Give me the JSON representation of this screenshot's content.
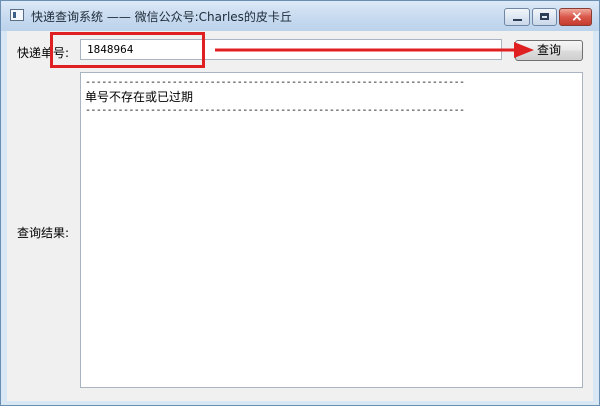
{
  "window": {
    "title": "快递查询系统 —— 微信公众号:Charles的皮卡丘",
    "buttons": {
      "minimize": "minimize",
      "maximize": "maximize",
      "close": "×"
    }
  },
  "form": {
    "tracking_label": "快递单号:",
    "tracking_value": "1848964",
    "query_button": "查询",
    "result_label": "查询结果:",
    "result_lines": [
      "----------------------------------------------------------------------",
      "单号不存在或已过期",
      "----------------------------------------------------------------------"
    ]
  },
  "annotation": {
    "color": "#e02020",
    "icons": [
      "highlight-box",
      "arrow"
    ]
  }
}
